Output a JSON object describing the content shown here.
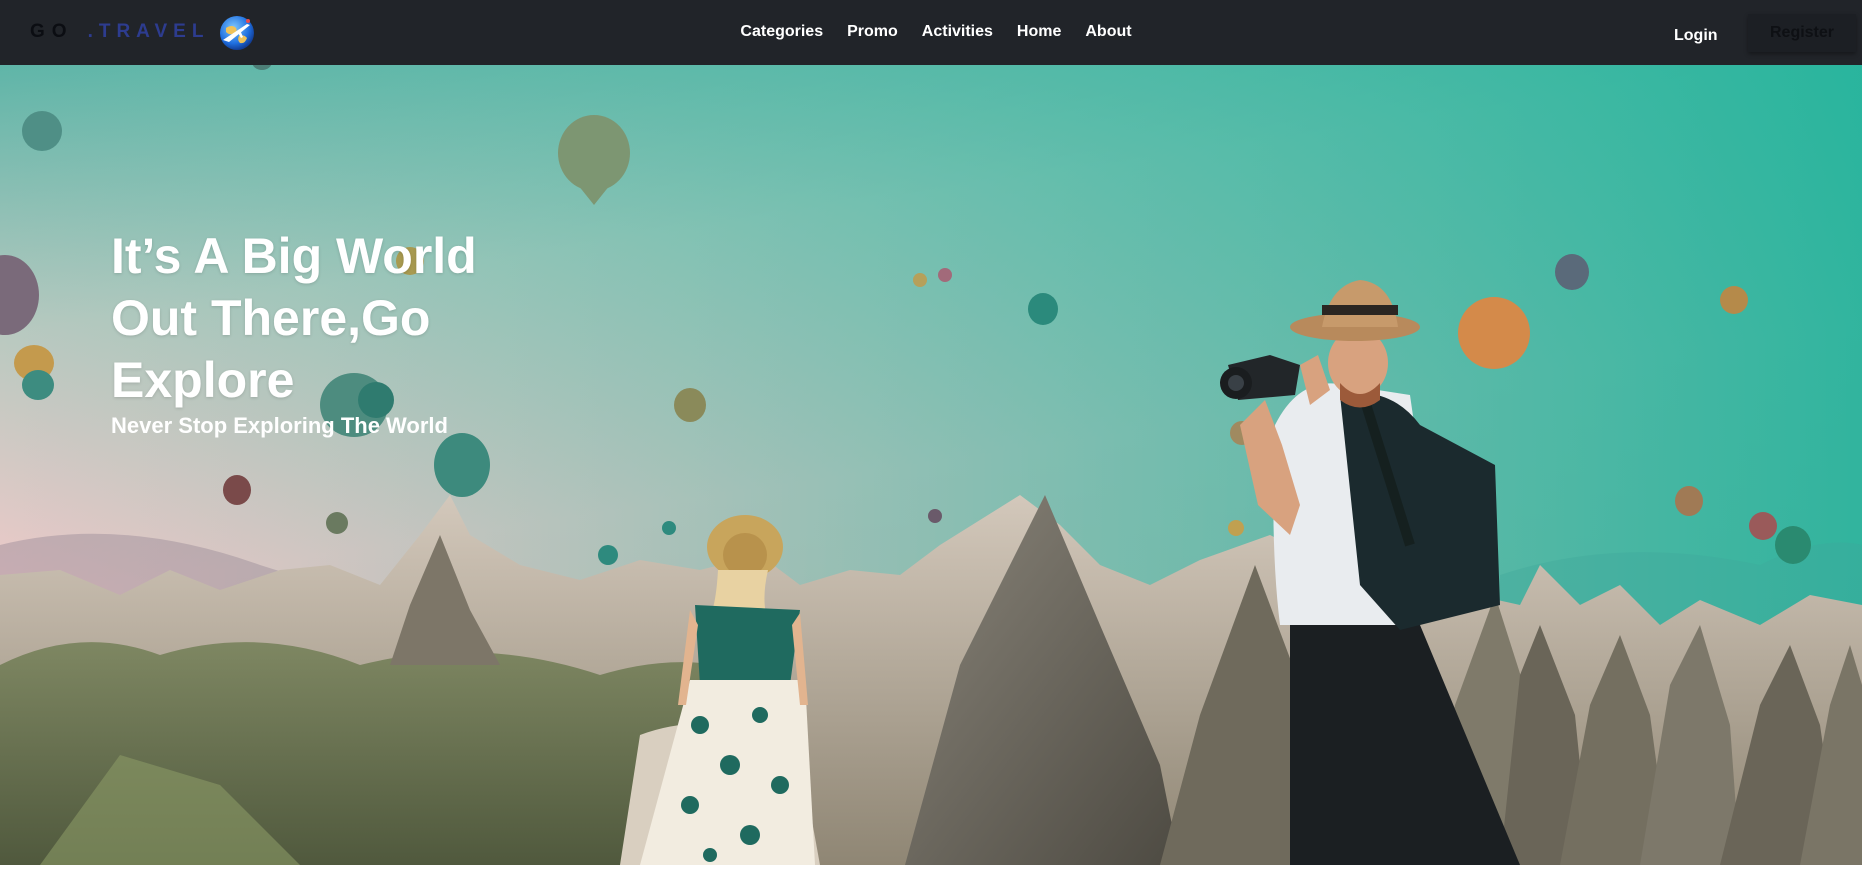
{
  "navbar": {
    "brand": {
      "go": "GO",
      "travel": ".TRAVEL",
      "logo_icon": "globe-airplane-icon"
    },
    "links": [
      "Categories",
      "Promo",
      "Activities",
      "Home",
      "About"
    ],
    "login": "Login",
    "register": "Register"
  },
  "hero": {
    "title": "It’s A Big World Out There,Go Explore",
    "subtitle": "Never Stop Exploring The World",
    "background": "hot-air-balloons-photo"
  },
  "colors": {
    "navbar_bg": "#212429",
    "brand_go": "#0b0d12",
    "brand_travel": "#2d3c8f",
    "sky_top": "#16b39a",
    "sky_bottom": "#f2c4c8",
    "hero_text": "#ffffff"
  }
}
